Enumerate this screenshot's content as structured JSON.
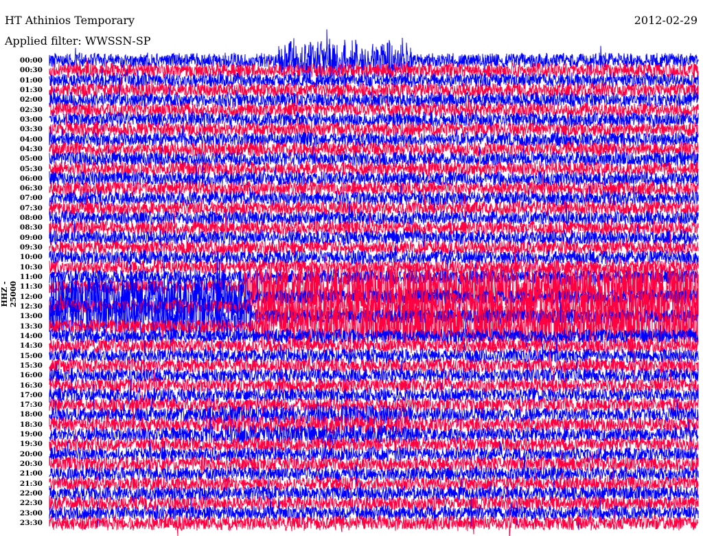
{
  "header": {
    "station": "HT Athinios Temporary",
    "filter": "Applied filter: WWSSN-SP",
    "date": "2012-02-29"
  },
  "chart_data": {
    "type": "helicorder",
    "title": "HT Athinios Temporary",
    "subtitle": "Applied filter: WWSSN-SP",
    "date": "2012-02-29",
    "ylabel": "HHZ - 25000",
    "row_minutes": 30,
    "row_labels": [
      "00:00",
      "00:30",
      "01:00",
      "01:30",
      "02:00",
      "02:30",
      "03:00",
      "03:30",
      "04:00",
      "04:30",
      "05:00",
      "05:30",
      "06:00",
      "06:30",
      "07:00",
      "07:30",
      "08:00",
      "08:30",
      "09:00",
      "09:30",
      "10:00",
      "10:30",
      "11:00",
      "11:30",
      "12:00",
      "12:30",
      "13:00",
      "13:30",
      "14:00",
      "14:30",
      "15:00",
      "15:30",
      "16:00",
      "16:30",
      "17:00",
      "17:30",
      "18:00",
      "18:30",
      "19:00",
      "19:30",
      "20:00",
      "20:30",
      "21:00",
      "21:30",
      "22:00",
      "22:30",
      "23:00",
      "23:30"
    ],
    "trace_colors": [
      "#0000ff",
      "#ff0040"
    ],
    "grid": false
  }
}
